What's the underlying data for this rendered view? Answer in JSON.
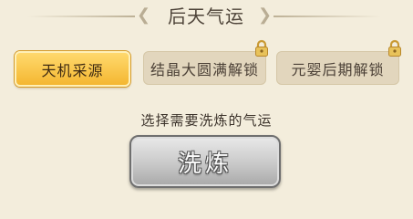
{
  "header": {
    "title": "后天气运"
  },
  "tabs": [
    {
      "label": "天机采源",
      "active": true,
      "locked": false
    },
    {
      "label": "结晶大圆满解锁",
      "active": false,
      "locked": true
    },
    {
      "label": "元婴后期解锁",
      "active": false,
      "locked": true
    }
  ],
  "prompt": "选择需要洗炼的气运",
  "wash_button": {
    "label": "洗炼"
  },
  "colors": {
    "background": "#f3eddc",
    "active_tab": "#f4b731",
    "locked_tab": "#e2d6bd",
    "lock_icon": "#e0b54a",
    "button_gray": "#c9c9c9"
  },
  "icons": [
    "ornament-icon",
    "lock-icon"
  ]
}
